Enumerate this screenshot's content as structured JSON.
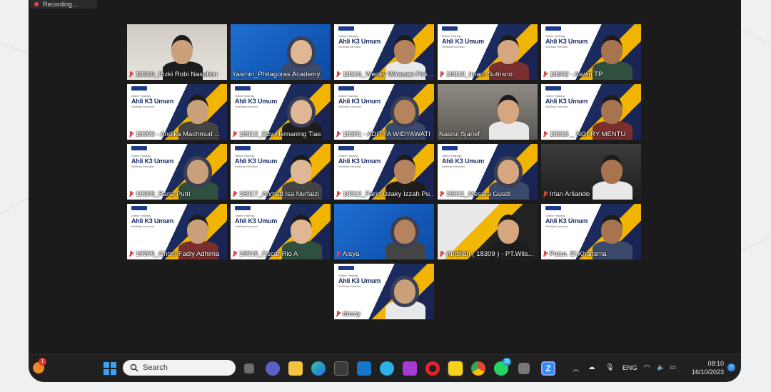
{
  "recording": {
    "label": "Recording..."
  },
  "participants": [
    {
      "name": "18310_Rizki Robi Nasution",
      "muted": true,
      "bg": "plain"
    },
    {
      "name": "Yasmin_Phitagoras Academy",
      "muted": false,
      "bg": "blue",
      "active": true
    },
    {
      "name": "18316_Wenky Wirawan Firs...",
      "muted": true,
      "bg": "slide"
    },
    {
      "name": "18319_Imam Sutrisno",
      "muted": true,
      "bg": "slide"
    },
    {
      "name": "18302 - Aswin TP",
      "muted": true,
      "bg": "slide"
    },
    {
      "name": "18303 - Andika Machmud ...",
      "muted": true,
      "bg": "slide"
    },
    {
      "name": "18313_Etty Hernaning Tias",
      "muted": true,
      "bg": "slide"
    },
    {
      "name": "18301 - ADITYA WIDYAWATI",
      "muted": true,
      "bg": "slide"
    },
    {
      "name": "Nasrul Sjarief",
      "muted": false,
      "bg": "room"
    },
    {
      "name": "18315 _ NOFRY MENTU",
      "muted": true,
      "bg": "slide"
    },
    {
      "name": "18308_Rana Putri",
      "muted": true,
      "bg": "slide"
    },
    {
      "name": "18317_Ahmad Isa Nurfaizi",
      "muted": true,
      "bg": "slide"
    },
    {
      "name": "18312_Farid Dzaky Izzah Pu...",
      "muted": true,
      "bg": "slide"
    },
    {
      "name": "18311_Mesara Gusdi",
      "muted": true,
      "bg": "slide"
    },
    {
      "name": "Irfan Arliando",
      "muted": true,
      "bg": "dark"
    },
    {
      "name": "18306_Ghoni Fadly Adhima",
      "muted": true,
      "bg": "slide"
    },
    {
      "name": "18318_Oscar Rio A",
      "muted": true,
      "bg": "slide"
    },
    {
      "name": "Aisya",
      "muted": true,
      "bg": "blue"
    },
    {
      "name": "Abdillah ( 18309 ) - PT.Wils...",
      "muted": true,
      "bg": "poster"
    },
    {
      "name": "Faiza. El Kharisma",
      "muted": true,
      "bg": "slide"
    },
    {
      "name": "dessy",
      "muted": true,
      "bg": "slide"
    }
  ],
  "slide": {
    "small": "Online Training",
    "title": "Ahli K3 Umum",
    "sub": "Sertifikasi Kemnaker"
  },
  "taskbar": {
    "search_placeholder": "Search",
    "notification_count": "1",
    "whatsapp_badge": "35",
    "language": "ENG",
    "time": "08:10",
    "date": "16/10/2023",
    "help_badge": "7"
  },
  "colors": {
    "active_border": "#24c34d",
    "muted_icon": "#e04343",
    "taskbar": "#202020"
  }
}
